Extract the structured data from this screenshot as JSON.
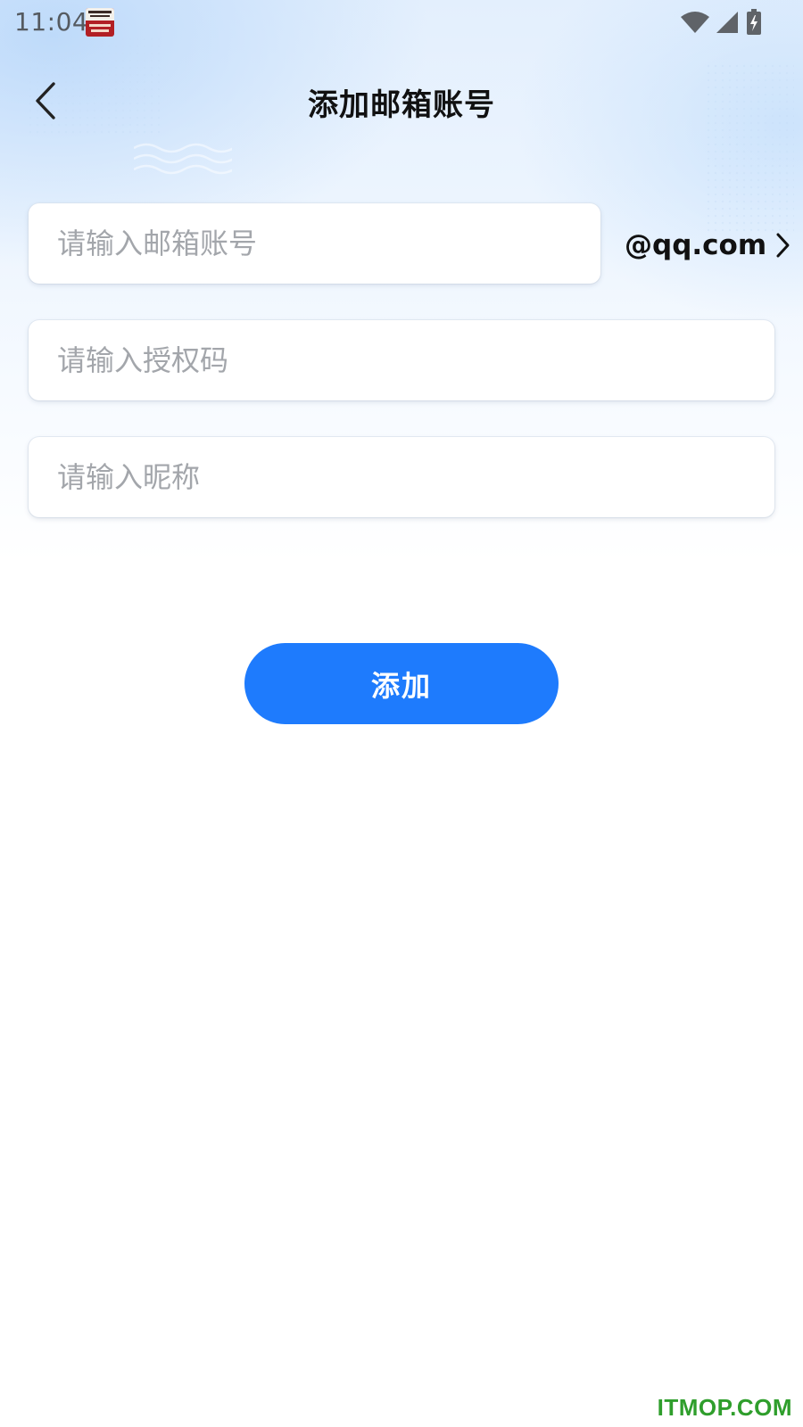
{
  "status_bar": {
    "time": "11:04",
    "icons": [
      "notification-app-icon",
      "wifi-icon",
      "cell-signal-icon",
      "battery-charging-icon"
    ]
  },
  "header": {
    "title": "添加邮箱账号",
    "back_icon": "chevron-left-icon"
  },
  "form": {
    "email_placeholder": "请输入邮箱账号",
    "email_value": "",
    "domain": "@qq.com",
    "domain_icon": "chevron-right-icon",
    "auth_code_placeholder": "请输入授权码",
    "auth_code_value": "",
    "nickname_placeholder": "请输入昵称",
    "nickname_value": ""
  },
  "actions": {
    "add_label": "添加"
  },
  "colors": {
    "accent": "#1e7bfd",
    "title_text": "#111111",
    "placeholder_text": "#a3a6ab",
    "watermark": "#2f9e2c"
  },
  "watermark": "ITMOP.COM"
}
